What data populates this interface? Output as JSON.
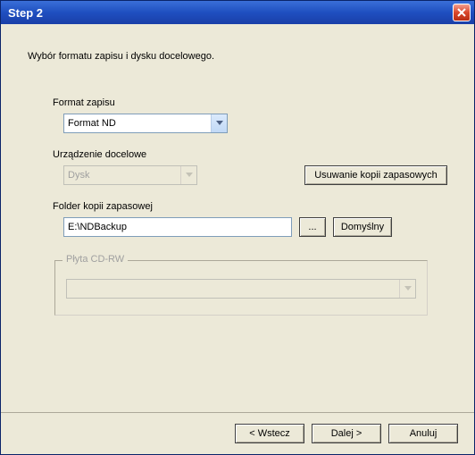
{
  "window": {
    "title": "Step 2"
  },
  "description": "Wybór formatu zapisu i dysku docelowego.",
  "format": {
    "label": "Format zapisu",
    "value": "Format ND"
  },
  "device": {
    "label": "Urządzenie docelowe",
    "value": "Dysk",
    "deleteBackups": "Usuwanie kopii zapasowych"
  },
  "folder": {
    "label": "Folder kopii zapasowej",
    "value": "E:\\NDBackup",
    "browse": "...",
    "default": "Domyślny"
  },
  "cdrw": {
    "label": "Płyta CD-RW",
    "value": ""
  },
  "footer": {
    "back": "< Wstecz",
    "next": "Dalej >",
    "cancel": "Anuluj"
  }
}
